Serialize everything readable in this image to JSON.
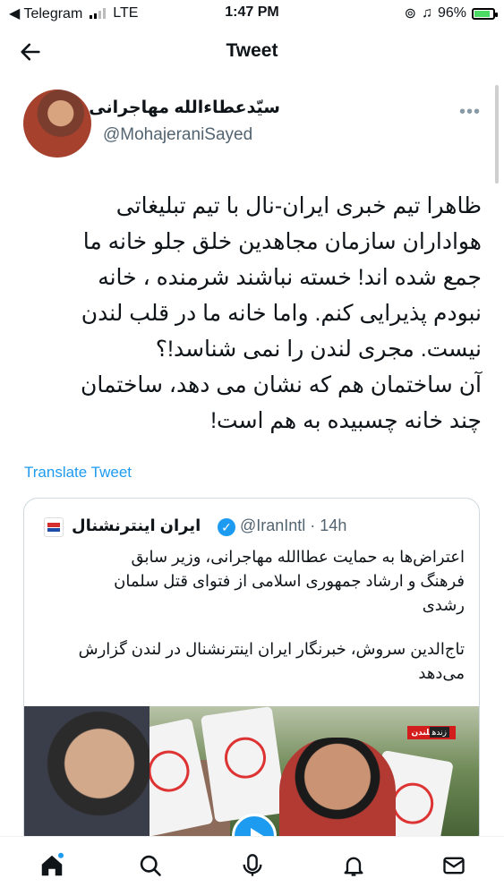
{
  "status_bar": {
    "carrier": "◀ Telegram",
    "network": "LTE",
    "time": "1:47 PM",
    "battery": "96%",
    "battery_level": 0.96
  },
  "header": {
    "title": "Tweet"
  },
  "tweet": {
    "author_name": "سیّدعطاءالله مهاجرانی",
    "handle": "@MohajeraniSayed",
    "text_lines": [
      "ظاهرا تیم خبری ایران-نال با تیم تبلیغاتی",
      "هواداران سازمان مجاهدین خلق جلو خانه ما",
      "جمع شده اند! خسته نباشند شرمنده ، خانه",
      "نبودم پذیرایی کنم. واما خانه ما در قلب لندن",
      "نیست. مجری لندن را نمی شناسد!؟",
      "آن ساختمان هم که نشان می دهد، ساختمان",
      "چند خانه چسبیده به هم است!"
    ],
    "translate_label": "Translate Tweet"
  },
  "quoted": {
    "name": "ایران اینترنشنال",
    "handle": "@IranIntl · 14h",
    "text_lines": [
      "اعتراض‌ها به حمایت عطاالله مهاجرانی، وزیر سابق",
      "فرهنگ و ارشاد جمهوری اسلامی از فتوای قتل سلمان",
      "رشدی"
    ],
    "text_lines_2": [
      "تاج‌الدین سروش، خبرنگار ایران اینترنشنال در لندن گزارش",
      "می‌دهد"
    ],
    "live_label": "لندن",
    "live_tag": "زنده"
  },
  "colors": {
    "accent": "#1d9bf0",
    "text": "#0f1419",
    "secondary": "#536471"
  },
  "nav": [
    "home-icon",
    "search-icon",
    "spaces-icon",
    "notifications-icon",
    "messages-icon"
  ]
}
